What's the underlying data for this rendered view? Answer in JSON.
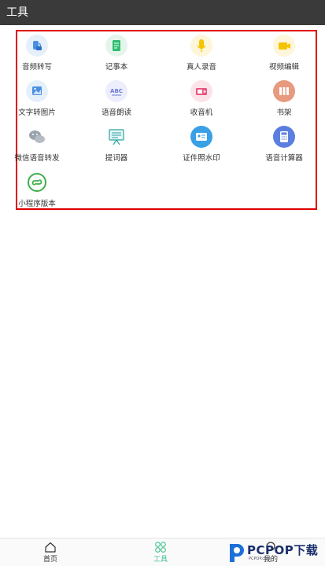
{
  "header": {
    "title": "工具"
  },
  "tools": [
    {
      "label": "音频转写",
      "icon": "audio-transcribe-icon",
      "color": "#4a90e2",
      "bg": "#e6f0fb"
    },
    {
      "label": "记事本",
      "icon": "notepad-icon",
      "color": "#2fbf71",
      "bg": "#e4f6ec"
    },
    {
      "label": "真人录音",
      "icon": "microphone-icon",
      "color": "#f5c400",
      "bg": "#fdf6da"
    },
    {
      "label": "视频编辑",
      "icon": "video-camera-icon",
      "color": "#f5c400",
      "bg": "#fdf6da"
    },
    {
      "label": "文字转图片",
      "icon": "text-to-image-icon",
      "color": "#4a90e2",
      "bg": "#e6f0fb"
    },
    {
      "label": "语音朗读",
      "icon": "abc-read-icon",
      "color": "#6c7bd6",
      "bg": "#eceefb"
    },
    {
      "label": "收音机",
      "icon": "radio-icon",
      "color": "#e9557f",
      "bg": "#fbe3ea"
    },
    {
      "label": "书架",
      "icon": "bookshelf-icon",
      "color": "#ffffff",
      "bg": "#e89a7e"
    },
    {
      "label": "微信语音转发",
      "icon": "wechat-icon",
      "color": "#9aa4ad",
      "bg": "#ffffff"
    },
    {
      "label": "提词器",
      "icon": "teleprompter-icon",
      "color": "#2aa3a3",
      "bg": "#ffffff"
    },
    {
      "label": "证件照水印",
      "icon": "id-card-icon",
      "color": "#ffffff",
      "bg": "#3aa0e6"
    },
    {
      "label": "语音计算器",
      "icon": "calculator-icon",
      "color": "#ffffff",
      "bg": "#5b7fe0"
    },
    {
      "label": "小程序版本",
      "icon": "mini-program-icon",
      "color": "#3fae49",
      "bg": "#ffffff"
    }
  ],
  "bottom_nav": [
    {
      "label": "首页",
      "icon": "home-icon",
      "active": false
    },
    {
      "label": "工具",
      "icon": "tools-grid-icon",
      "active": true
    },
    {
      "label": "我的",
      "icon": "profile-icon",
      "active": false
    }
  ],
  "watermark": {
    "text": "PCPOP下载",
    "sub": "PCPOP.com"
  },
  "colors": {
    "accent": "#3fc18d",
    "header_bg": "#3a3a3a",
    "highlight_border": "#e00000"
  }
}
